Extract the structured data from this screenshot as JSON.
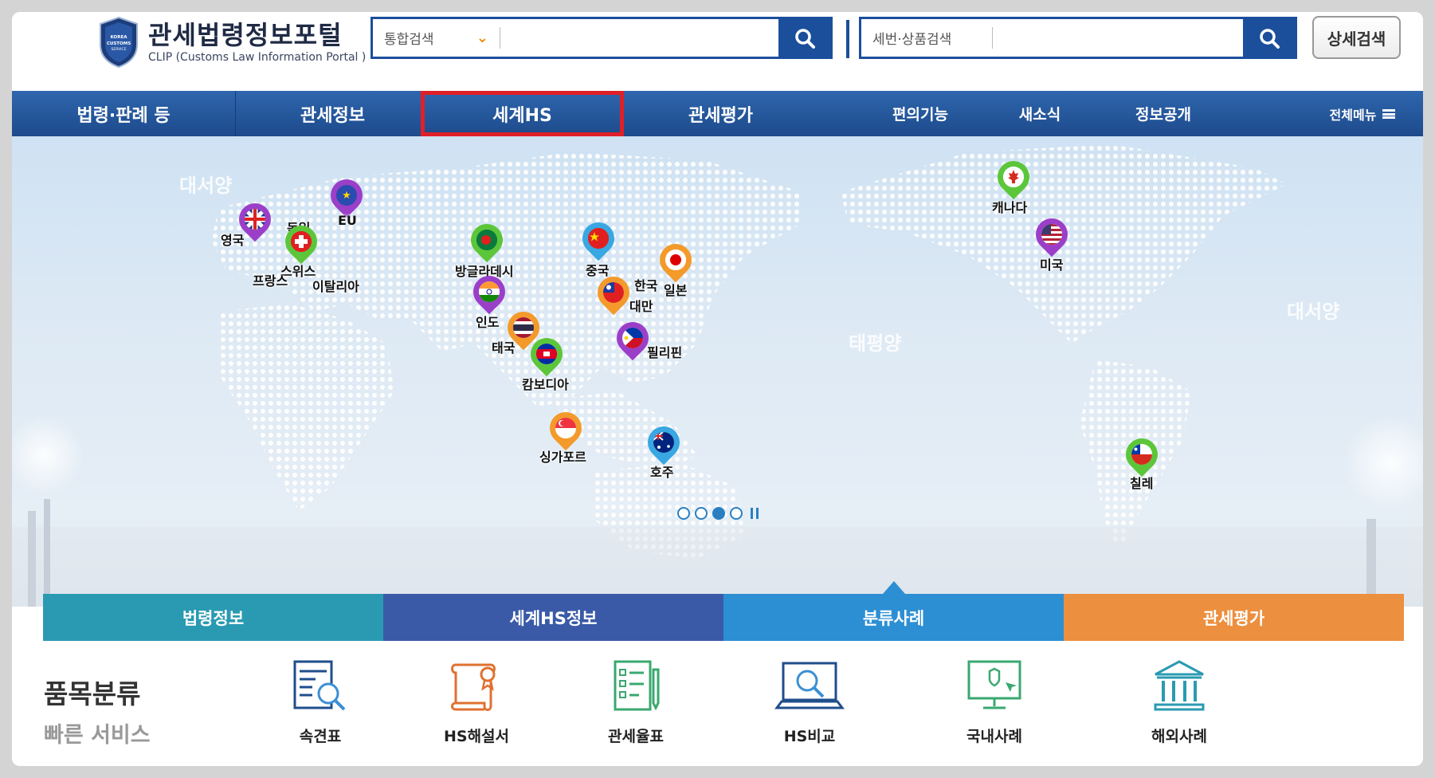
{
  "header": {
    "logo_title": "관세법령정보포털",
    "logo_subtitle": "CLIP (Customs Law Information Portal )",
    "badge_text": "KOREA CUSTOMS SERVICE",
    "search1_select": "통합검색",
    "search1_placeholder": "",
    "search2_label": "세번·상품검색",
    "search2_placeholder": "",
    "detail_search": "상세검색"
  },
  "nav": {
    "items": [
      "법령·판례 등",
      "관세정보",
      "세계HS",
      "관세평가",
      "편의기능",
      "새소식",
      "정보공개",
      "전체메뉴"
    ],
    "highlighted": "세계HS",
    "highlight_color": "#e02028"
  },
  "map": {
    "oceans": [
      "대서양",
      "태평양",
      "대서양"
    ],
    "countries": [
      "영국",
      "독일",
      "EU",
      "스위스",
      "프랑스",
      "이탈리아",
      "방글라데시",
      "인도",
      "태국",
      "캄보디아",
      "중국",
      "한국",
      "일본",
      "대만",
      "필리핀",
      "싱가포르",
      "호주",
      "캐나다",
      "미국",
      "칠레"
    ],
    "flag_texts": {
      "eu": "★"
    },
    "pager_active": 3
  },
  "tabs": [
    "법령정보",
    "세계HS정보",
    "분류사례",
    "관세평가"
  ],
  "quick": {
    "title": "품목분류",
    "subtitle": "빠른 서비스",
    "items": [
      "속견표",
      "HS해설서",
      "관세율표",
      "HS비교",
      "국내사례",
      "해외사례"
    ]
  },
  "colors": {
    "primary": "#1b4f9c",
    "accent_orange": "#f08a00",
    "tab1": "#2a9ab2",
    "tab2": "#3a5aa8",
    "tab3": "#2d8fd3",
    "tab4": "#ec8f3e"
  }
}
